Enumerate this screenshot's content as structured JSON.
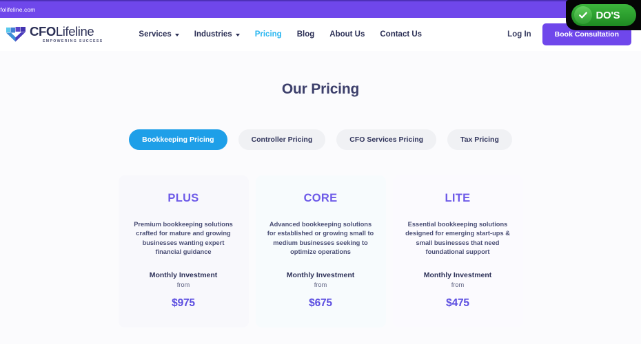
{
  "browser": {
    "url_text": "cfolifeline.com",
    "bar_color": "#6f47eb"
  },
  "header": {
    "logo": {
      "word_bold": "CFO",
      "word_light": "Lifeline",
      "tagline": "EMPOWERING SUCCESS"
    },
    "nav": [
      {
        "label": "Services",
        "has_caret": true,
        "active": false
      },
      {
        "label": "Industries",
        "has_caret": true,
        "active": false
      },
      {
        "label": "Pricing",
        "has_caret": false,
        "active": true
      },
      {
        "label": "Blog",
        "has_caret": false,
        "active": false
      },
      {
        "label": "About Us",
        "has_caret": false,
        "active": false
      },
      {
        "label": "Contact Us",
        "has_caret": false,
        "active": false
      }
    ],
    "login_label": "Log In",
    "cta_label": "Book Consultation",
    "accent_color": "#6f47eb",
    "active_nav_color": "#29b6f0"
  },
  "main": {
    "title": "Our Pricing",
    "tabs": [
      {
        "label": "Bookkeeping Pricing",
        "active": true
      },
      {
        "label": "Controller Pricing",
        "active": false
      },
      {
        "label": "CFO Services Pricing",
        "active": false
      },
      {
        "label": "Tax Pricing",
        "active": false
      }
    ],
    "active_tab_color": "#1e9fe8",
    "plans": [
      {
        "name": "PLUS",
        "description": "Premium bookkeeping solutions crafted for mature and growing businesses wanting expert financial guidance",
        "investment_label": "Monthly Investment",
        "from_label": "from",
        "price": "$975"
      },
      {
        "name": "CORE",
        "description": "Advanced bookkeeping solutions for established or growing small to medium businesses seeking to optimize operations",
        "investment_label": "Monthly Investment",
        "from_label": "from",
        "price": "$675"
      },
      {
        "name": "LITE",
        "description": "Essential bookkeeping solutions designed for emerging start-ups & small businesses that need foundational support",
        "investment_label": "Monthly Investment",
        "from_label": "from",
        "price": "$475"
      }
    ],
    "price_color": "#5b4de0"
  },
  "overlay": {
    "badge_label": "DO'S",
    "badge_icon": "check-circle-icon",
    "badge_color": "#2f9e32"
  }
}
